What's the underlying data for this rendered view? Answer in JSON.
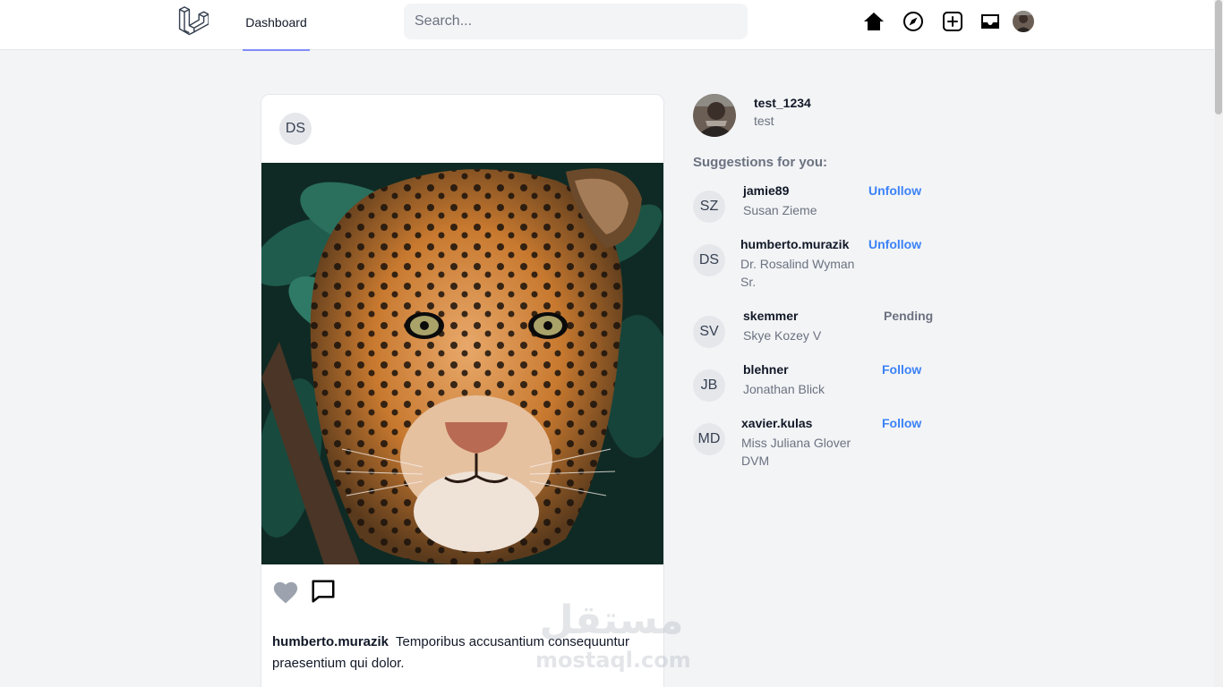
{
  "nav": {
    "dashboard_label": "Dashboard",
    "search_placeholder": "Search...",
    "icons": [
      "home-icon",
      "compass-icon",
      "plus-square-icon",
      "inbox-icon"
    ]
  },
  "post": {
    "author_initials": "DS",
    "image_alt": "jaguar",
    "caption_user": "humberto.murazik",
    "caption_text": "Temporibus accusantium consequuntur praesentium qui dolor."
  },
  "me": {
    "username": "test_1234",
    "name": "test"
  },
  "suggestions": {
    "title": "Suggestions for you:",
    "items": [
      {
        "initials": "SZ",
        "username": "jamie89",
        "name": "Susan Zieme",
        "action": "Unfollow"
      },
      {
        "initials": "DS",
        "username": "humberto.murazik",
        "name": "Dr. Rosalind Wyman Sr.",
        "action": "Unfollow"
      },
      {
        "initials": "SV",
        "username": "skemmer",
        "name": "Skye Kozey V",
        "action": "Pending"
      },
      {
        "initials": "JB",
        "username": "blehner",
        "name": "Jonathan Blick",
        "action": "Follow"
      },
      {
        "initials": "MD",
        "username": "xavier.kulas",
        "name": "Miss Juliana Glover DVM",
        "action": "Follow"
      }
    ]
  },
  "watermark": {
    "arabic": "مستقل",
    "latin": "mostaql.com"
  },
  "colors": {
    "accent": "#3b82f6",
    "nav_underline": "#818cf8",
    "background": "#f3f4f6"
  }
}
